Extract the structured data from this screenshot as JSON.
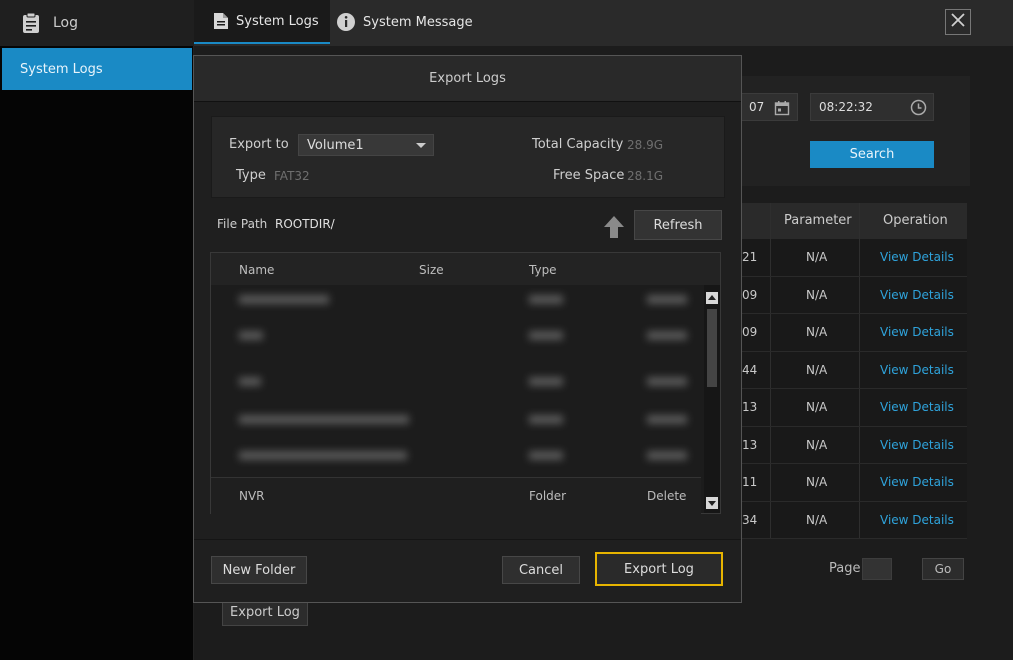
{
  "window": {
    "title": "Log"
  },
  "sidebar": {
    "items": [
      {
        "label": "System Logs"
      }
    ]
  },
  "tabs": [
    {
      "label": "System Logs"
    },
    {
      "label": "System Message"
    }
  ],
  "filters": {
    "date_partial": "07",
    "time": "08:22:32",
    "search_label": "Search"
  },
  "log_table": {
    "headers": {
      "parameter": "Parameter",
      "operation": "Operation"
    },
    "rows": [
      {
        "time_partial": "21",
        "parameter": "N/A",
        "operation": "View Details"
      },
      {
        "time_partial": "09",
        "parameter": "N/A",
        "operation": "View Details"
      },
      {
        "time_partial": "09",
        "parameter": "N/A",
        "operation": "View Details"
      },
      {
        "time_partial": "44",
        "parameter": "N/A",
        "operation": "View Details"
      },
      {
        "time_partial": "13",
        "parameter": "N/A",
        "operation": "View Details"
      },
      {
        "time_partial": "13",
        "parameter": "N/A",
        "operation": "View Details"
      },
      {
        "time_partial": "11",
        "parameter": "N/A",
        "operation": "View Details"
      },
      {
        "time_partial": "34",
        "parameter": "N/A",
        "operation": "View Details"
      }
    ]
  },
  "pagination": {
    "page_label": "Page",
    "go_label": "Go"
  },
  "background_export_label": "Export Log",
  "dialog": {
    "title": "Export Logs",
    "export_to_label": "Export to",
    "export_to_value": "Volume1",
    "type_label": "Type",
    "type_value": "FAT32",
    "total_capacity_label": "Total Capacity",
    "total_capacity_value": "28.9G",
    "free_space_label": "Free Space",
    "free_space_value": "28.1G",
    "file_path_label": "File Path",
    "file_path_value": "ROOTDIR/",
    "refresh_label": "Refresh",
    "file_list": {
      "headers": {
        "name": "Name",
        "size": "Size",
        "type": "Type"
      },
      "visible_row": {
        "name": "NVR",
        "type": "Folder",
        "action": "Delete"
      }
    },
    "buttons": {
      "new_folder": "New Folder",
      "cancel": "Cancel",
      "export_log": "Export Log"
    }
  },
  "colors": {
    "accent_blue": "#1a8ac5",
    "highlight_yellow": "#e7b400",
    "link_blue": "#2fa3db"
  }
}
